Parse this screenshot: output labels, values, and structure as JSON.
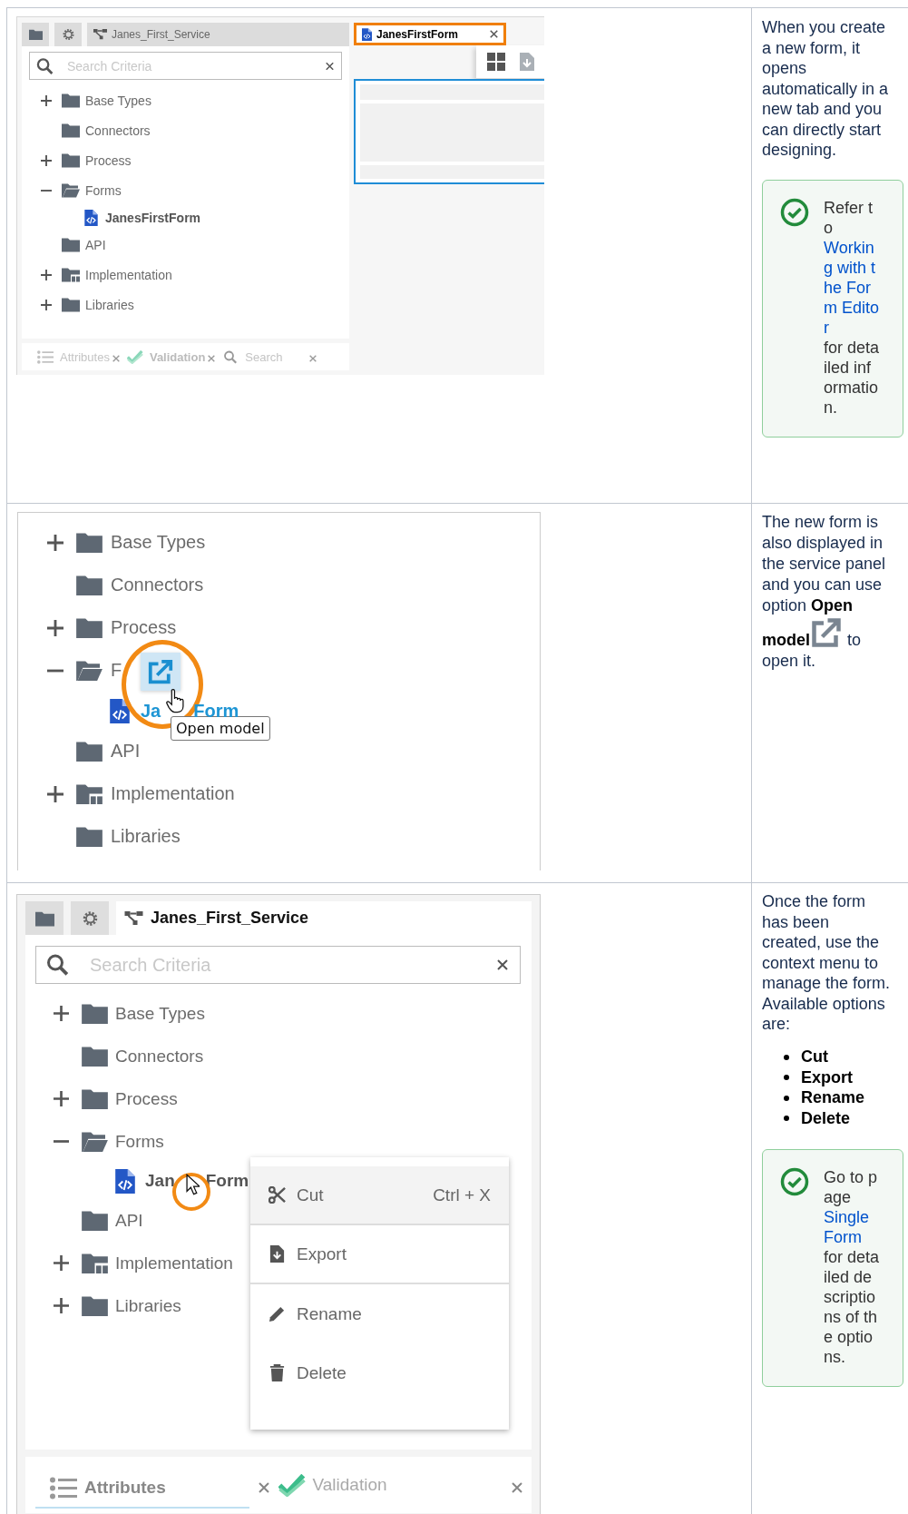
{
  "rows": [
    {
      "screenshot": {
        "kind": "editor_view",
        "panel_tabs": [
          {
            "kind": "folder",
            "selected": false
          },
          {
            "kind": "gear",
            "selected": false
          },
          {
            "kind": "service",
            "label": "Janes_First_Service",
            "selected": false
          }
        ],
        "search": {
          "placeholder": "Search Criteria"
        },
        "tree": [
          {
            "kind": "folder",
            "label": "Base Types",
            "expandable": true,
            "expanded": false
          },
          {
            "kind": "folder",
            "label": "Connectors",
            "expandable": false
          },
          {
            "kind": "folder",
            "label": "Process",
            "expandable": true,
            "expanded": false
          },
          {
            "kind": "folder",
            "label": "Forms",
            "expandable": true,
            "expanded": true,
            "children": [
              {
                "kind": "form",
                "label_parts": [
                  "JanesFirstForm"
                ],
                "expandable": false,
                "hovered": false
              }
            ]
          },
          {
            "kind": "folder",
            "label": "API",
            "expandable": false
          },
          {
            "kind": "implementation",
            "label": "Implementation",
            "expandable": true,
            "expanded": false
          },
          {
            "kind": "folder",
            "label": "Libraries",
            "expandable": true,
            "expanded": false
          }
        ],
        "bottom_tabs": [
          {
            "kind": "attributes",
            "label": "Attributes",
            "selected": false
          },
          {
            "kind": "validation",
            "label": "Validation",
            "selected": false
          },
          {
            "kind": "search",
            "label": "Search",
            "selected": false
          }
        ],
        "editor_tab": {
          "label": "JanesFirstForm",
          "highlighted": true
        }
      },
      "description": [
        {
          "kind": "paragraph",
          "parts": [
            {
              "kind": "text",
              "text": "When you create a new form, it opens automatically in a new tab and you can directly start designing."
            }
          ]
        },
        {
          "kind": "note",
          "parts": [
            {
              "kind": "text",
              "text": "Refer to "
            },
            {
              "kind": "link",
              "text": "Working with the Form Editor"
            },
            {
              "kind": "text",
              "text": " for detailed information."
            }
          ]
        }
      ]
    },
    {
      "screenshot": {
        "kind": "tree_tooltip",
        "tree": [
          {
            "kind": "folder",
            "label": "Base Types",
            "expandable": true,
            "expanded": false
          },
          {
            "kind": "folder",
            "label": "Connectors",
            "expandable": false
          },
          {
            "kind": "folder",
            "label": "Process",
            "expandable": true,
            "expanded": false
          },
          {
            "kind": "folder",
            "label": "F",
            "expandable": true,
            "expanded": true,
            "children": [
              {
                "kind": "form",
                "label_parts": [
                  "Ja",
                  "Form"
                ],
                "expandable": false,
                "hovered": true
              }
            ]
          },
          {
            "kind": "folder",
            "label": "API",
            "expandable": false
          },
          {
            "kind": "implementation",
            "label": "Implementation",
            "expandable": true,
            "expanded": false
          },
          {
            "kind": "folder",
            "label": "Libraries",
            "expandable": false
          }
        ],
        "tooltip": "Open model"
      },
      "description": [
        {
          "kind": "paragraph",
          "parts": [
            {
              "kind": "text",
              "text": "The new form is also displayed in the service panel and you can use option "
            },
            {
              "kind": "bold",
              "text": "Open model"
            },
            {
              "kind": "icon"
            },
            {
              "kind": "text",
              "text": " to open it."
            }
          ]
        }
      ]
    },
    {
      "screenshot": {
        "kind": "service_menu",
        "panel_tabs": [
          {
            "kind": "folder",
            "selected": false
          },
          {
            "kind": "gear",
            "selected": false
          },
          {
            "kind": "service",
            "label": "Janes_First_Service",
            "selected": true
          }
        ],
        "search": {
          "placeholder": "Search Criteria"
        },
        "tree": [
          {
            "kind": "folder",
            "label": "Base Types",
            "expandable": true,
            "expanded": false
          },
          {
            "kind": "folder",
            "label": "Connectors",
            "expandable": false
          },
          {
            "kind": "folder",
            "label": "Process",
            "expandable": true,
            "expanded": false
          },
          {
            "kind": "folder",
            "label": "Forms",
            "expandable": true,
            "expanded": true,
            "children": [
              {
                "kind": "form",
                "label_parts": [
                  "Jan",
                  "Form"
                ],
                "expandable": false,
                "hovered": false
              }
            ]
          },
          {
            "kind": "folder",
            "label": "API",
            "expandable": false
          },
          {
            "kind": "implementation",
            "label": "Implementation",
            "expandable": true,
            "expanded": false
          },
          {
            "kind": "folder",
            "label": "Libraries",
            "expandable": true,
            "expanded": false
          }
        ],
        "context_menu": [
          {
            "kind": "cut",
            "label": "Cut",
            "shortcut": "Ctrl + X",
            "selected": true,
            "divider_after": true
          },
          {
            "kind": "export",
            "label": "Export",
            "selected": false,
            "divider_after": true
          },
          {
            "kind": "rename",
            "label": "Rename",
            "selected": false,
            "divider_after": false
          },
          {
            "kind": "delete",
            "label": "Delete",
            "selected": false,
            "divider_after": false
          }
        ],
        "bottom_tabs": [
          {
            "kind": "attributes",
            "label": "Attributes",
            "selected": true
          },
          {
            "kind": "validation",
            "label": "Validation",
            "selected": false
          }
        ]
      },
      "description": [
        {
          "kind": "paragraph",
          "parts": [
            {
              "kind": "text",
              "text": "Once the form has been created, use the context menu to manage the form. Available options are:"
            }
          ]
        },
        {
          "kind": "bullets",
          "items": [
            "Cut",
            "Export",
            "Rename",
            "Delete"
          ]
        },
        {
          "kind": "note",
          "parts": [
            {
              "kind": "text",
              "text": "Go to page "
            },
            {
              "kind": "link",
              "text": "Single Form"
            },
            {
              "kind": "text",
              "text": " for detailed descriptions of the options."
            }
          ]
        }
      ]
    }
  ]
}
